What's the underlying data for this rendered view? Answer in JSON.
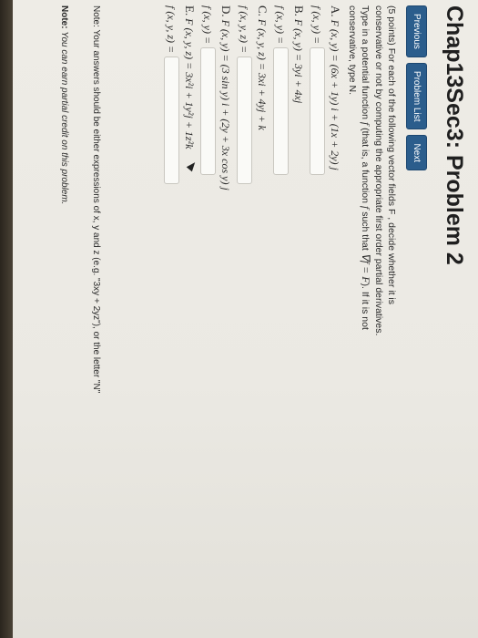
{
  "header": {
    "title": "Chap13Sec3: Problem 2"
  },
  "nav": {
    "previous": "Previous",
    "problem_list": "Problem List",
    "next": "Next"
  },
  "problem": {
    "points": "(5 points)",
    "intro_a": "For each of the following vector fields F , decide whether it is conservative or not by computing the appropriate first order partial derivatives. Type in a potential function",
    "f_symbol": "f",
    "intro_b": "(that is, a function",
    "intro_c": "such that",
    "grad_eq": "∇f = F",
    "intro_d": "). If it is not conservative, type N.",
    "items": [
      {
        "label": "A.",
        "field": "F (x, y) = (6x + 1y) i + (1x + 2y) j",
        "answer_label": "f (x, y) =",
        "answer": ""
      },
      {
        "label": "B.",
        "field": "F (x, y) = 3yi + 4xj",
        "answer_label": "f (x, y) =",
        "answer": ""
      },
      {
        "label": "C.",
        "field": "F (x, y, z) = 3xi + 4yj + k",
        "answer_label": "f (x, y, z) =",
        "answer": ""
      },
      {
        "label": "D.",
        "field": "F (x, y) = (3 sin y) i + (2y + 3x cos y) j",
        "answer_label": "f (x, y) =",
        "answer": ""
      },
      {
        "label": "E.",
        "field": "F (x, y, z) = 3x²i + 1y²j + 1z²k",
        "answer_label": "f (x, y, z) =",
        "answer": ""
      }
    ],
    "note": "Note: Your answers should be either expressions of x, y and z (e.g. \"3xy + 2yz\"), or the letter \"N\""
  },
  "footer": {
    "credit_prefix": "Note:",
    "credit_text": "You can earn partial credit on this problem."
  },
  "colors": {
    "button_bg": "#2b5d8c",
    "page_bg": "#eeece6",
    "input_bg": "#fafaf7"
  }
}
